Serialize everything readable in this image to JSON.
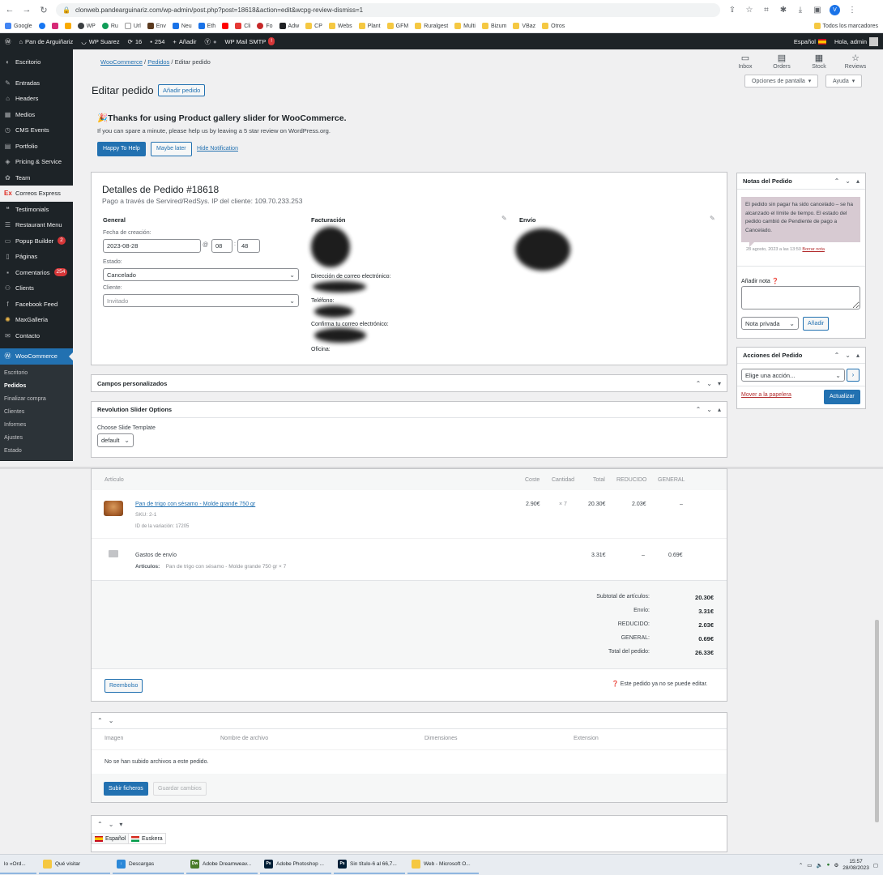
{
  "browser": {
    "url": "clonweb.pandearguinariz.com/wp-admin/post.php?post=18618&action=edit&wcpg-review-dismiss=1",
    "profile_initial": "V",
    "bookmarks": [
      "Google",
      "WP",
      "Ru",
      "Url",
      "Env",
      "Neu",
      "Eth",
      "Cli",
      "Fo",
      "Adw",
      "CP",
      "Webs",
      "Plant",
      "GFM",
      "Ruralgest",
      "Multi",
      "Bizum",
      "VBaz",
      "Otros"
    ],
    "all_bookmarks": "Todos los marcadores"
  },
  "adminbar": {
    "site_name": "Pan de Arguiñariz",
    "wp_suarez": "WP Suarez",
    "updates_count": "16",
    "comments_count": "254",
    "add_new": "Añadir",
    "mail_smtp": "WP Mail SMTP",
    "mail_badge": "!",
    "language": "Español",
    "greeting": "Hola, admin"
  },
  "sidebar": {
    "items": [
      {
        "label": "Escritorio",
        "icon": "dashboard-icon"
      },
      {
        "label": "Entradas",
        "icon": "pin-icon"
      },
      {
        "label": "Headers",
        "icon": "home-icon"
      },
      {
        "label": "Medios",
        "icon": "media-icon"
      },
      {
        "label": "CMS Events",
        "icon": "clock-icon"
      },
      {
        "label": "Portfolio",
        "icon": "portfolio-icon"
      },
      {
        "label": "Pricing & Service",
        "icon": "tag-icon"
      },
      {
        "label": "Team",
        "icon": "team-icon"
      },
      {
        "label": "Correos Express",
        "icon": "ex-icon"
      },
      {
        "label": "Testimonials",
        "icon": "quote-icon"
      },
      {
        "label": "Restaurant Menu",
        "icon": "menu-icon"
      },
      {
        "label": "Popup Builder",
        "icon": "popup-icon",
        "badge": "2"
      },
      {
        "label": "Páginas",
        "icon": "page-icon"
      },
      {
        "label": "Comentarios",
        "icon": "comment-icon",
        "badge": "254"
      },
      {
        "label": "Clients",
        "icon": "clients-icon"
      },
      {
        "label": "Facebook Feed",
        "icon": "facebook-icon"
      },
      {
        "label": "MaxGalleria",
        "icon": "gallery-icon"
      },
      {
        "label": "Contacto",
        "icon": "mail-icon"
      },
      {
        "label": "WooCommerce",
        "icon": "woo-icon"
      }
    ],
    "submenu": [
      "Escritorio",
      "Pedidos",
      "Finalizar compra",
      "Clientes",
      "Informes",
      "Ajustes",
      "Estado"
    ]
  },
  "breadcrumb": {
    "root": "WooCommerce",
    "section": "Pedidos",
    "current": "Editar pedido"
  },
  "wc_toolbar": {
    "inbox": "Inbox",
    "orders": "Orders",
    "stock": "Stock",
    "reviews": "Reviews"
  },
  "screen_options": "Opciones de pantalla",
  "help": "Ayuda",
  "page": {
    "title": "Editar pedido",
    "add_order": "Añadir pedido"
  },
  "notice": {
    "title": "Thanks for using Product gallery slider for WooCommerce.",
    "text": "If you can spare a minute, please help us by leaving a 5 star review on WordPress.org.",
    "happy": "Happy To Help",
    "maybe": "Maybe later",
    "hide": "Hide Notification"
  },
  "order": {
    "title": "Detalles de Pedido #18618",
    "subtitle": "Pago a través de Servired/RedSys. IP del cliente: 109.70.233.253",
    "general": "General",
    "date_label": "Fecha de creación:",
    "date": "2023-08-28",
    "at": "@",
    "hour": "08",
    "minute": "48",
    "status_label": "Estado:",
    "status": "Cancelado",
    "customer_label": "Cliente:",
    "customer": "Invitado",
    "billing": "Facturación",
    "shipping": "Envío",
    "email_label": "Dirección de correo electrónico:",
    "phone_label": "Teléfono:",
    "confirm_email_label": "Confirma tu correo electrónico:",
    "office_label": "Oficina:"
  },
  "notes": {
    "title": "Notas del Pedido",
    "note": "El pedido sin pagar ha sido cancelado – se ha alcanzado el límite de tiempo. El estado del pedido cambió de Pendiente de pago a Cancelado.",
    "meta": "28 agosto, 2023 a las 13:50",
    "delete": "Borrar nota",
    "add_label": "Añadir nota",
    "type": "Nota privada",
    "add_btn": "Añadir"
  },
  "actions": {
    "title": "Acciones del Pedido",
    "select": "Elige una acción...",
    "go": "›",
    "trash": "Mover a la papelera",
    "update": "Actualizar"
  },
  "custom_fields": "Campos personalizados",
  "slider": {
    "title": "Revolution Slider Options",
    "label": "Choose Slide Template",
    "value": "default"
  },
  "items": {
    "headers": {
      "item": "Artículo",
      "cost": "Coste",
      "qty": "Cantidad",
      "total": "Total",
      "reduced": "REDUCIDO",
      "general": "GENERAL"
    },
    "product": {
      "name": "Pan de trigo con sésamo - Molde grande 750 gr",
      "sku": "SKU: 2-1",
      "variation": "ID de la variación: 17205",
      "cost": "2.90€",
      "qty": "× 7",
      "total": "20.30€",
      "reduced": "2.03€",
      "general": "–"
    },
    "shipping": {
      "name": "Gastos de envío",
      "articles_label": "Artículos:",
      "articles": "Pan de trigo con sésamo - Molde grande 750 gr × 7",
      "total": "3.31€",
      "reduced": "–",
      "general": "0.69€"
    },
    "totals": [
      {
        "label": "Subtotal de artículos:",
        "value": "20.30€"
      },
      {
        "label": "Envío:",
        "value": "3.31€"
      },
      {
        "label": "REDUCIDO:",
        "value": "2.03€"
      },
      {
        "label": "GENERAL:",
        "value": "0.69€"
      },
      {
        "label": "Total del pedido:",
        "value": "26.33€"
      }
    ],
    "refund": "Reembolso",
    "no_edit": "Este pedido ya no se puede editar."
  },
  "files": {
    "headers": [
      "Imagen",
      "Nombre de archivo",
      "Dimensiones",
      "Extension"
    ],
    "empty": "No se han subido archivos a este pedido.",
    "upload": "Subir ficheros",
    "save": "Guardar cambios"
  },
  "languages": [
    "Español",
    "Euskera"
  ],
  "taskbar": {
    "tasks": [
      "lo «Ord...",
      "Qué visitar",
      "Descargas",
      "Adobe Dreamweav...",
      "Adobe Photoshop ...",
      "Sin título-6 al 66,7...",
      "Web - Microsoft O..."
    ],
    "time": "15:57",
    "date": "28/08/2023"
  }
}
